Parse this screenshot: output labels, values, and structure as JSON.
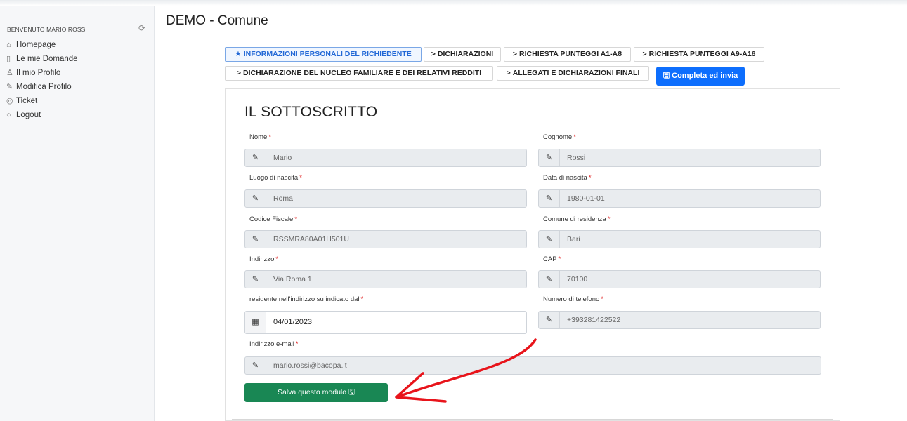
{
  "sidebar": {
    "welcome": "BENVENUTO MARIO ROSSI",
    "cloud_icon": "cloud-sync-icon",
    "items": [
      {
        "label": "Homepage",
        "icon": "home-icon"
      },
      {
        "label": "Le mie Domande",
        "icon": "map-icon"
      },
      {
        "label": "Il mio Profilo",
        "icon": "user-icon"
      },
      {
        "label": "Modifica Profilo",
        "icon": "edit-icon"
      },
      {
        "label": "Ticket",
        "icon": "compass-icon"
      },
      {
        "label": "Logout",
        "icon": "circle-icon"
      }
    ]
  },
  "header": {
    "title": "DEMO - Comune"
  },
  "tabs": [
    {
      "label": "INFORMAZIONI PERSONALI DEL RICHIEDENTE",
      "prefix": "★",
      "active": true
    },
    {
      "label": "DICHIARAZIONI",
      "prefix": ">"
    },
    {
      "label": "RICHIESTA PUNTEGGI A1-A8",
      "prefix": ">"
    },
    {
      "label": "RICHIESTA PUNTEGGI A9-A16",
      "prefix": ">"
    },
    {
      "label": "DICHIARAZIONE DEL NUCLEO FAMILIARE E DEI RELATIVI REDDITI",
      "prefix": ">"
    },
    {
      "label": "ALLEGATI E DICHIARAZIONI FINALI",
      "prefix": ">"
    }
  ],
  "complete_button": {
    "label": "Completa ed invia",
    "icon": "save-icon"
  },
  "form": {
    "title": "IL SOTTOSCRITTO",
    "required_mark": "*",
    "fields": {
      "nome": {
        "label": "Nome",
        "value": "Mario"
      },
      "cognome": {
        "label": "Cognome",
        "value": "Rossi"
      },
      "luogo": {
        "label": "Luogo di nascita",
        "value": "Roma"
      },
      "data": {
        "label": "Data di nascita",
        "value": "1980-01-01"
      },
      "cf": {
        "label": "Codice Fiscale",
        "value": "RSSMRA80A01H501U"
      },
      "comune": {
        "label": "Comune di residenza",
        "value": "Bari"
      },
      "indirizzo": {
        "label": "Indirizzo",
        "value": "Via Roma 1"
      },
      "cap": {
        "label": "CAP",
        "value": "70100"
      },
      "residente": {
        "label": "residente nell'indirizzo su indicato dal",
        "value": "04/01/2023"
      },
      "telefono": {
        "label": "Numero di telefono",
        "value": "+393281422522"
      },
      "email": {
        "label": "Indirizzo e-mail",
        "value": "mario.rossi@bacopa.it"
      }
    },
    "save_button": {
      "label": "Salva questo modulo",
      "icon": "save-icon"
    }
  },
  "colors": {
    "primary": "#0d6efd",
    "success": "#198754",
    "annotation": "#e8141b",
    "required": "#e02020"
  }
}
